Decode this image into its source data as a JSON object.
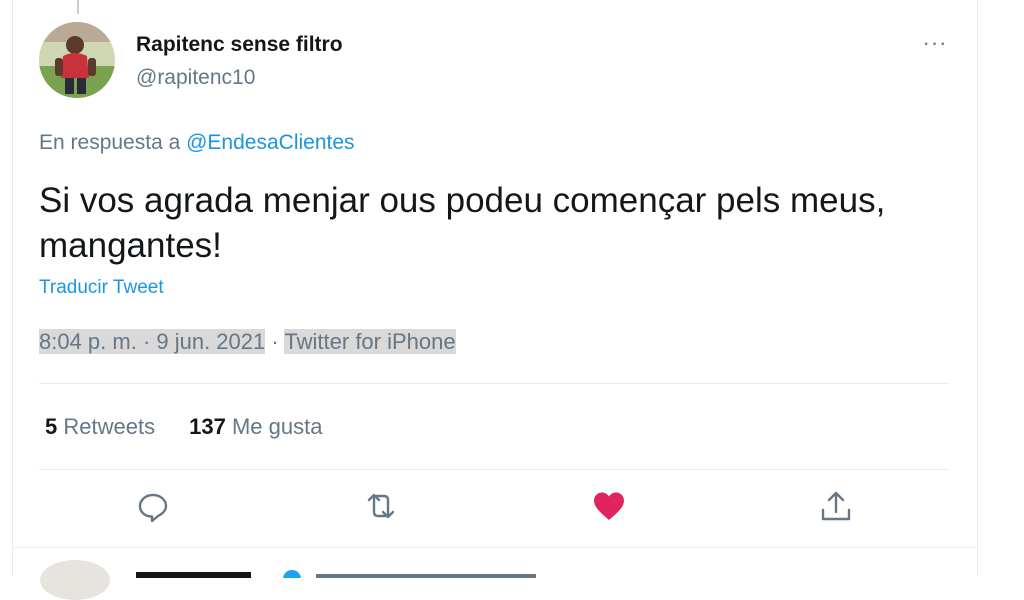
{
  "tweet": {
    "display_name": "Rapitenc sense filtro",
    "handle": "@rapitenc10",
    "reply_prefix": "En respuesta a",
    "reply_to": "@EndesaClientes",
    "text": "Si vos agrada menjar ous podeu començar pels meus, mangantes!",
    "translate_label": "Traducir Tweet",
    "timestamp": "8:04 p. m. · 9 jun. 2021",
    "separator": " · ",
    "source": "Twitter for iPhone",
    "more_label": "···"
  },
  "stats": {
    "retweets_count": "5",
    "retweets_label": "Retweets",
    "likes_count": "137",
    "likes_label": "Me gusta"
  },
  "actions": {
    "reply_icon": "comment-icon",
    "retweet_icon": "retweet-icon",
    "like_icon": "heart-filled-icon",
    "share_icon": "share-icon",
    "like_color": "#e0245e",
    "icon_color": "#657786"
  }
}
